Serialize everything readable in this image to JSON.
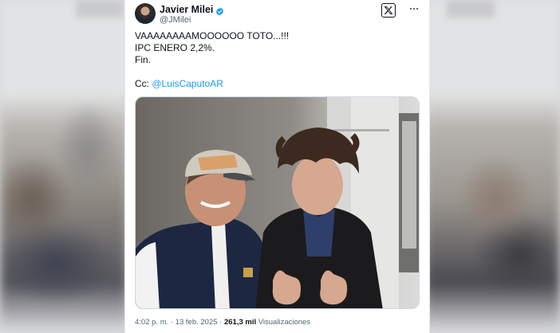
{
  "tweet": {
    "display_name": "Javier Milei",
    "handle": "@JMilei",
    "verified": true,
    "lines": [
      "VAAAAAAAAMOOOOOO TOTO...!!!",
      "IPC ENERO 2,2%.",
      "Fin."
    ],
    "cc_label": "Cc: ",
    "mention": "@LuisCaputoAR",
    "timestamp": "4:02 p. m. · 13 feb. 2025 · ",
    "views_count": "261,3 mil",
    "views_label": "Visualizaciones"
  },
  "icons": {
    "x_logo": "x-logo-icon",
    "more": "more-icon",
    "verified": "verified-badge-icon"
  },
  "colors": {
    "link": "#1d9bf0",
    "verified": "#1d9bf0",
    "text": "#0f1419",
    "muted": "#536471"
  }
}
